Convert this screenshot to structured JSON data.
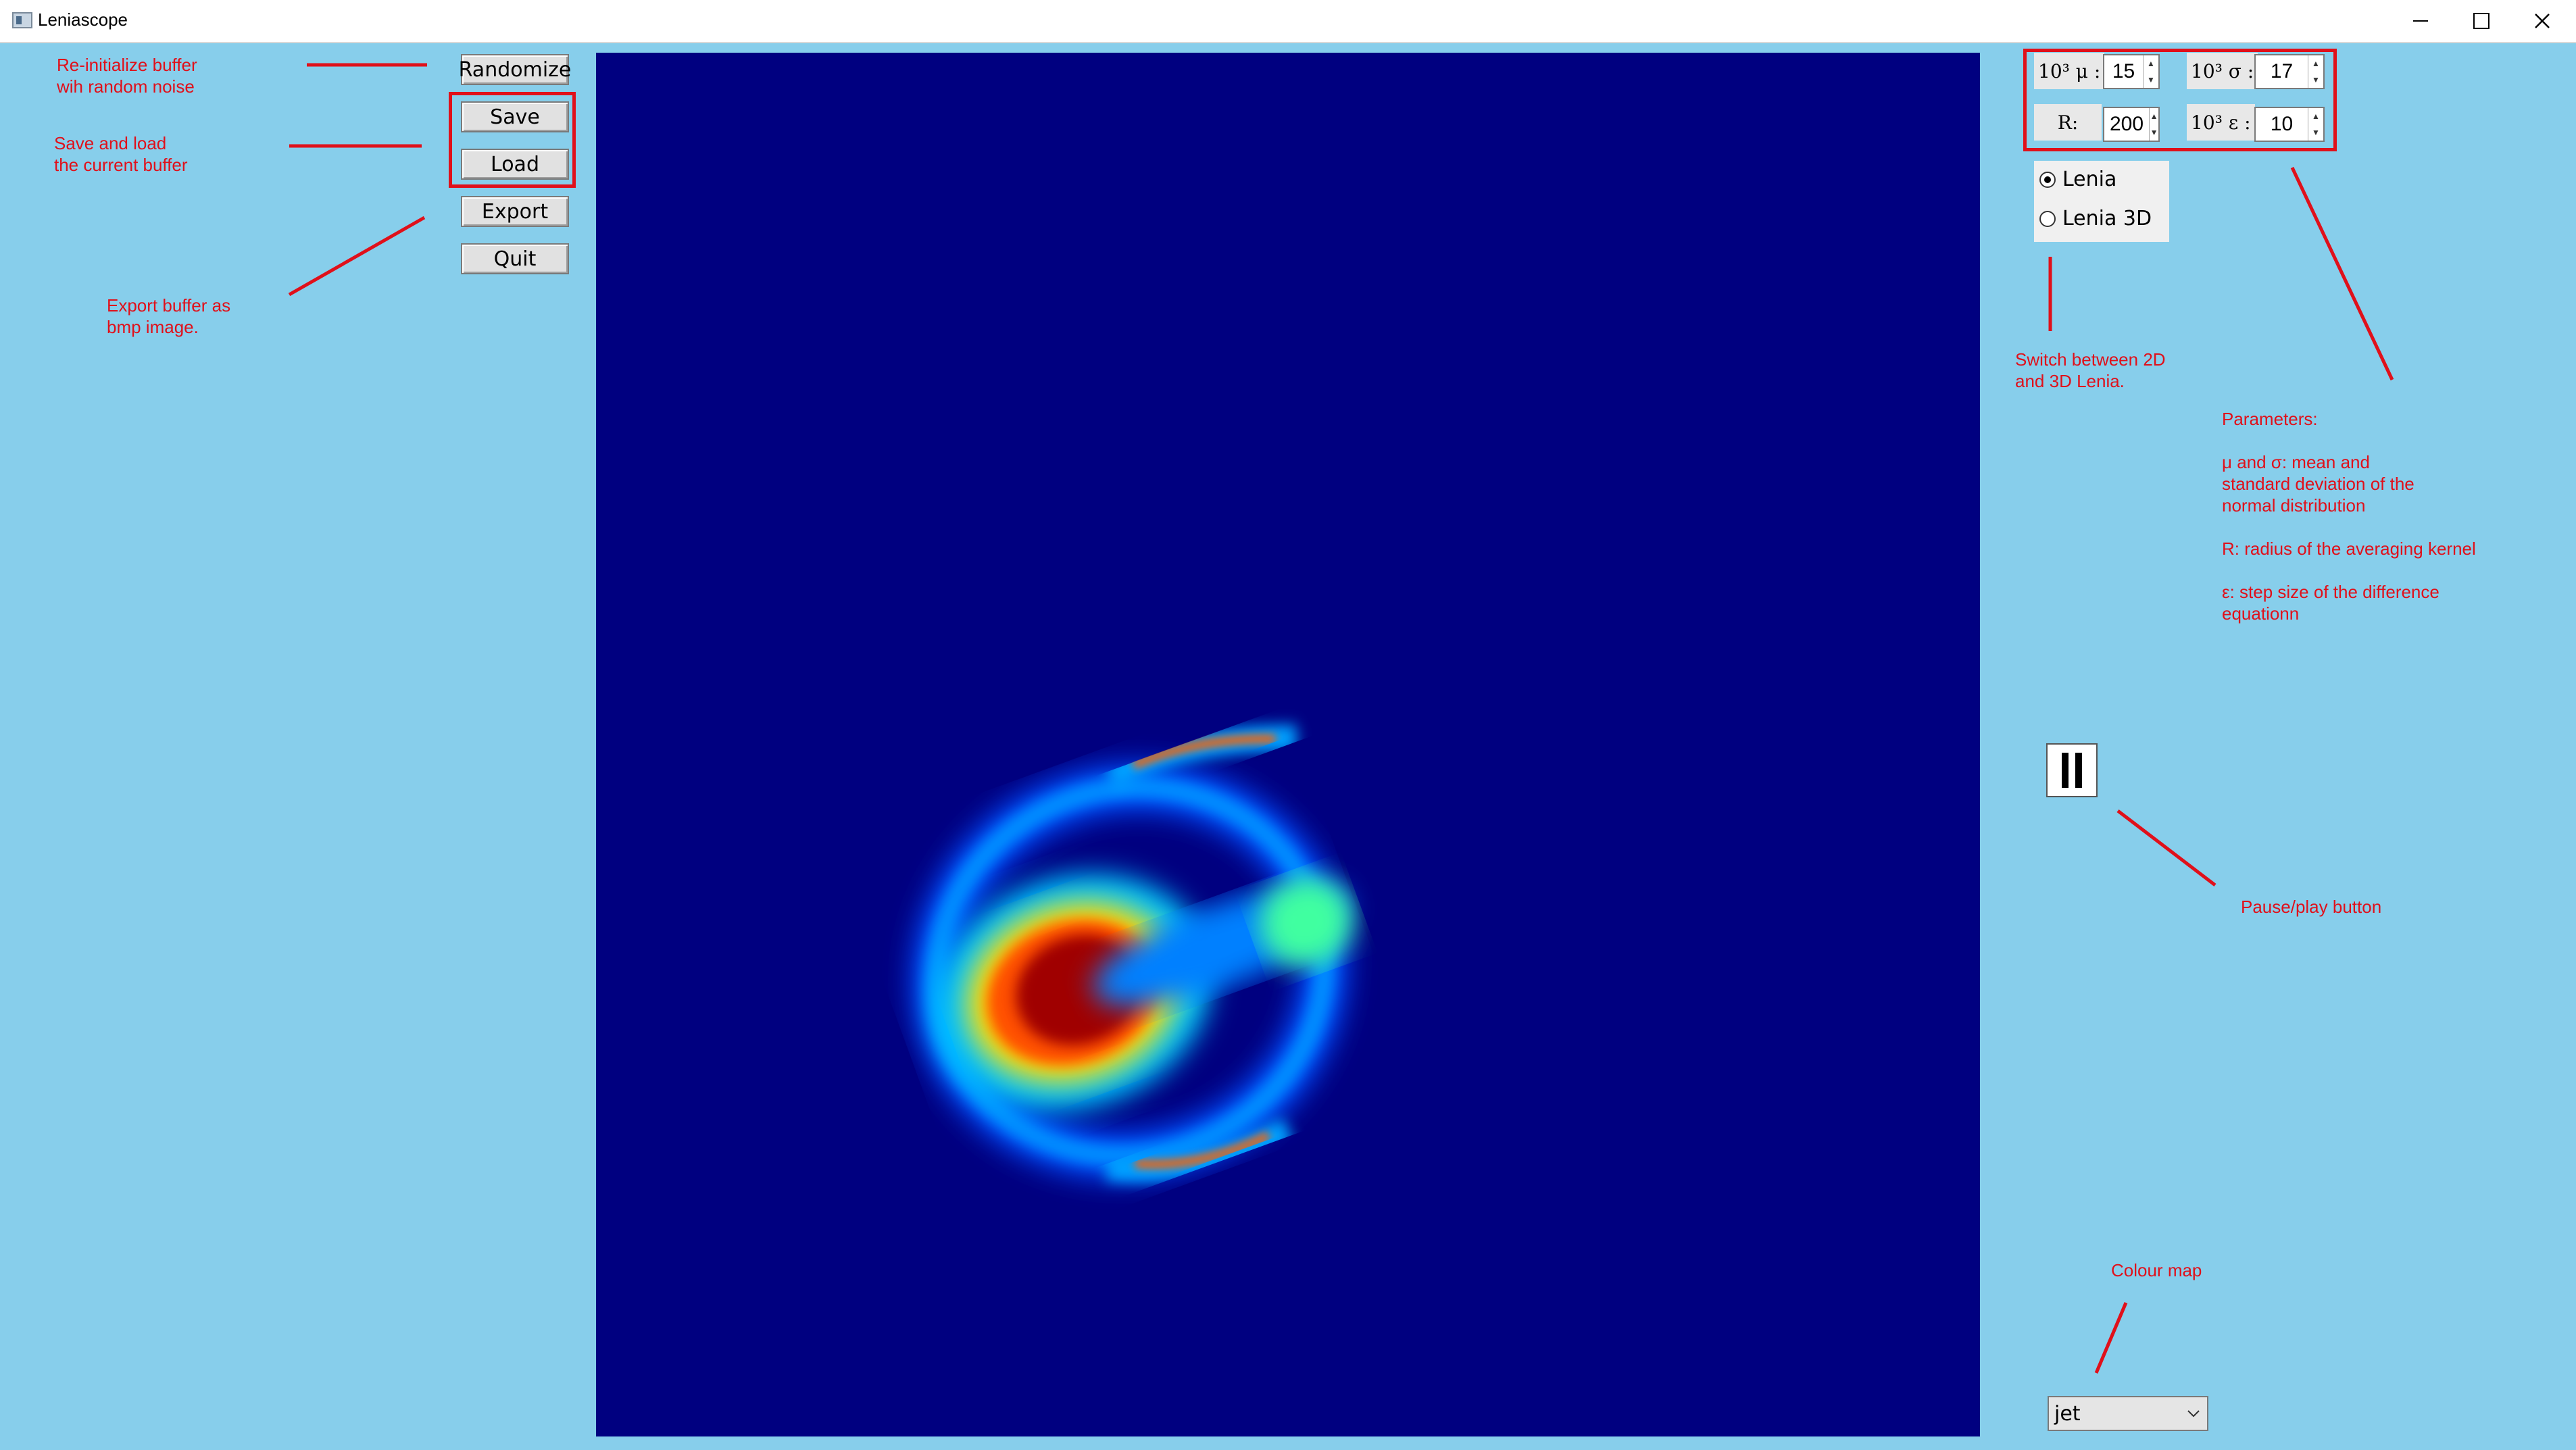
{
  "window": {
    "title": "Leniascope"
  },
  "buttons": {
    "randomize": "Randomize",
    "save": "Save",
    "load": "Load",
    "export": "Export",
    "quit": "Quit"
  },
  "notes": {
    "randomize": "Re-initialize buffer\nwih random noise",
    "save_load": "Save and load\nthe current buffer",
    "export": "Export buffer as\nbmp image.",
    "switch": "Switch between 2D\nand 3D Lenia.",
    "parameters": "Parameters:\n\nμ and σ: mean and\nstandard deviation of the\nnormal distribution\n\nR: radius of the averaging kernel\n\nε: step size of the difference\nequationn",
    "pause": "Pause/play button",
    "colour_map": "Colour map"
  },
  "params": {
    "mu_label": "10³ μ :",
    "mu_value": "15",
    "sigma_label": "10³ σ :",
    "sigma_value": "17",
    "r_label": "R:",
    "r_value": "200",
    "eps_label": "10³ ε :",
    "eps_value": "10"
  },
  "mode": {
    "options": [
      "Lenia",
      "Lenia 3D"
    ],
    "selected": "Lenia"
  },
  "colour_map": {
    "selected": "jet"
  },
  "colors": {
    "background": "#87ceeb",
    "canvas": "#000080",
    "annotation": "#e0101a"
  }
}
